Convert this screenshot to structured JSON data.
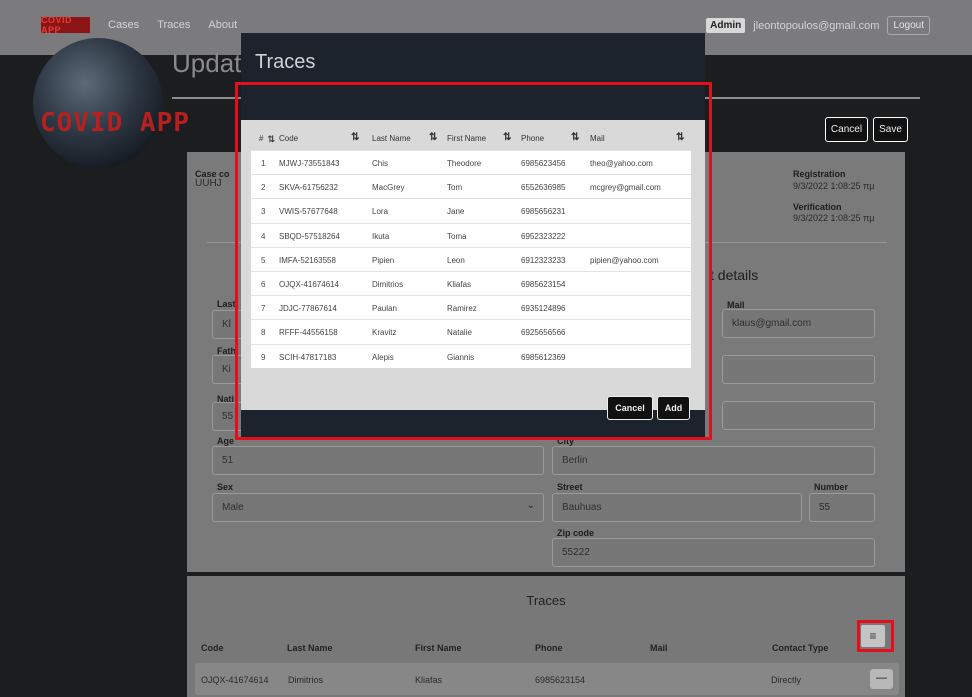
{
  "navbar": {
    "brand": "COVID APP",
    "links": [
      "Cases",
      "Traces",
      "About"
    ],
    "role": "Admin",
    "email": "jleontopoulos@gmail.com",
    "logout": "Logout"
  },
  "logo_text": "COVID APP",
  "page": {
    "title": "Update",
    "cancel": "Cancel",
    "save": "Save"
  },
  "case": {
    "code_label": "Case co",
    "code_value": "UUHJ",
    "registration_label": "Registration",
    "registration_value": "9/3/2022 1:08:25 πμ",
    "verification_label": "Verification",
    "verification_value": "9/3/2022 1:08:25 πμ",
    "contact_details_heading": "t details",
    "last_label": "Last",
    "last_value": "Kl",
    "father_label": "Fath",
    "father_value": "Ki",
    "nat_label": "Nati",
    "nat_value": "55",
    "mail_label": "Mail",
    "mail_value": "klaus@gmail.com",
    "age_label": "Age",
    "age_value": "51",
    "city_label": "City",
    "city_value": "Berlin",
    "sex_label": "Sex",
    "sex_value": "Male",
    "street_label": "Street",
    "street_value": "Bauhuas",
    "number_label": "Number",
    "number_value": "55",
    "zip_label": "Zip code",
    "zip_value": "55222"
  },
  "traces_section": {
    "title": "Traces",
    "headers": [
      "Code",
      "Last Name",
      "First Name",
      "Phone",
      "Mail",
      "Contact Type"
    ],
    "rows": [
      {
        "code": "OJQX-41674614",
        "last": "Dimitrios",
        "first": "Kliafas",
        "phone": "6985623154",
        "mail": "",
        "type": "Directly"
      }
    ]
  },
  "modal": {
    "title": "Traces",
    "headers": [
      "#",
      "Code",
      "Last Name",
      "First Name",
      "Phone",
      "Mail"
    ],
    "rows": [
      {
        "n": "1",
        "code": "MJWJ-73551843",
        "last": "Chis",
        "first": "Theodore",
        "phone": "6985623456",
        "mail": "theo@yahoo.com"
      },
      {
        "n": "2",
        "code": "SKVA-61756232",
        "last": "MacGrey",
        "first": "Tom",
        "phone": "6552636985",
        "mail": "mcgrey@gmail.com"
      },
      {
        "n": "3",
        "code": "VWIS-57677648",
        "last": "Lora",
        "first": "Jane",
        "phone": "6985656231",
        "mail": ""
      },
      {
        "n": "4",
        "code": "SBQD-57518264",
        "last": "Ikuta",
        "first": "Toma",
        "phone": "6952323222",
        "mail": ""
      },
      {
        "n": "5",
        "code": "IMFA-52163558",
        "last": "Pipien",
        "first": "Leon",
        "phone": "6912323233",
        "mail": "pipien@yahoo.com"
      },
      {
        "n": "6",
        "code": "OJQX-41674614",
        "last": "Dimitrios",
        "first": "Kliafas",
        "phone": "6985623154",
        "mail": ""
      },
      {
        "n": "7",
        "code": "JDJC-77867614",
        "last": "Paulan",
        "first": "Ramirez",
        "phone": "6935124896",
        "mail": ""
      },
      {
        "n": "8",
        "code": "RFFF-44556158",
        "last": "Kravitz",
        "first": "Natalie",
        "phone": "6925656566",
        "mail": ""
      },
      {
        "n": "9",
        "code": "SCIH-47817183",
        "last": "Alepis",
        "first": "Giannis",
        "phone": "6985612369",
        "mail": ""
      }
    ],
    "cancel": "Cancel",
    "add": "Add"
  },
  "icons": {
    "sort": "sort-icon",
    "list": "list-icon",
    "minus": "minus-icon",
    "dropdown": "chevron-down-icon"
  },
  "colors": {
    "highlight": "#e3101b",
    "logo_red": "#b52020"
  }
}
